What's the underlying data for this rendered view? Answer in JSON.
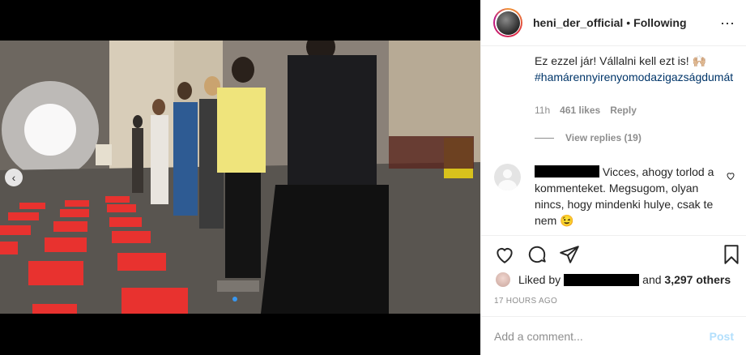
{
  "post": {
    "media_alt": "photo post",
    "carousel": {
      "dots": 1,
      "active": 0
    }
  },
  "header": {
    "username": "heni_der_official",
    "separator": "•",
    "follow_status": "Following",
    "more_icon": "⋯"
  },
  "comments": [
    {
      "text": "Ez ezzel jár! Vállalni kell ezt is! 🙌🏼",
      "hashtag": "#hamárennyirenyomodazigazságdumát",
      "time": "11h",
      "likes": "461 likes",
      "reply_label": "Reply",
      "view_replies": "View replies (19)"
    },
    {
      "username_redacted": true,
      "text": " Vicces, ahogy torlod a kommenteket. Megsugom, olyan nincs, hogy mindenki hulye, csak te nem 😉"
    }
  ],
  "actions": {
    "like_icon": "heart-icon",
    "comment_icon": "comment-icon",
    "share_icon": "share-icon",
    "save_icon": "bookmark-icon"
  },
  "likes": {
    "prefix": "Liked by",
    "and": "and",
    "others": "3,297 others"
  },
  "timestamp": "17 HOURS AGO",
  "add_comment": {
    "placeholder": "Add a comment...",
    "post_label": "Post"
  },
  "colors": {
    "link": "#003569",
    "muted": "#8e8e8e",
    "post_disabled": "#b2dffc",
    "accent": "#3897f0"
  }
}
